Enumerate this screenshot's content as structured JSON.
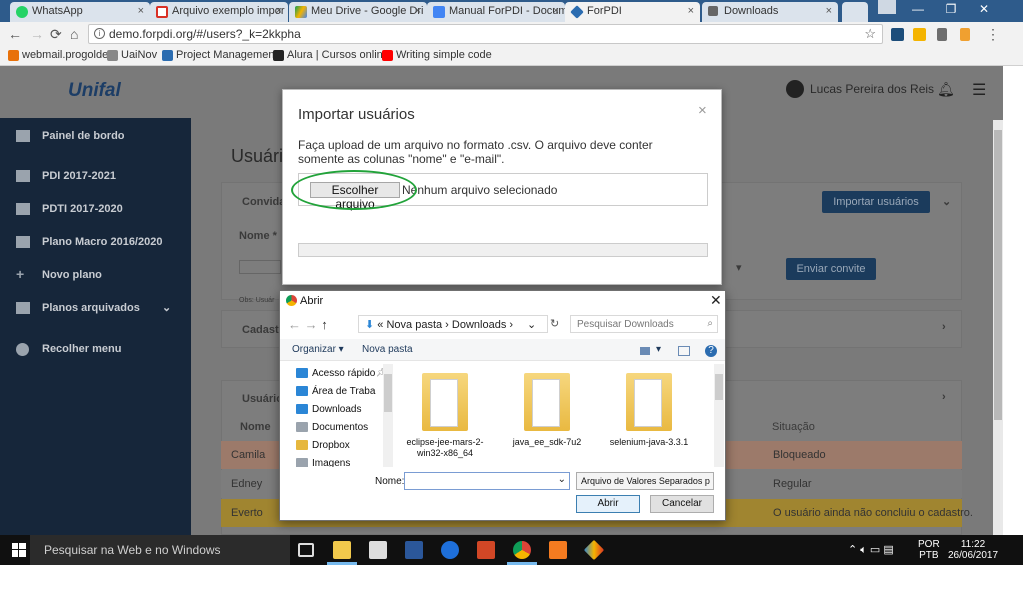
{
  "browser": {
    "tabs": [
      {
        "label": "WhatsApp",
        "color": "#25d366"
      },
      {
        "label": "Arquivo exemplo impor",
        "color": "#d93025"
      },
      {
        "label": "Meu Drive - Google Dri",
        "color": "#f4b400"
      },
      {
        "label": "Manual ForPDI - Docum",
        "color": "#4285f4"
      },
      {
        "label": "ForPDI",
        "color": "#2b6cb0"
      },
      {
        "label": "Downloads",
        "color": "#666666"
      }
    ],
    "tab_close": "×",
    "url": "demo.forpdi.org/#/users?_k=2kkpha",
    "win_min": "—",
    "win_max": "❐",
    "win_close": "✕"
  },
  "bookmarks": [
    {
      "label": "webmail.progolden",
      "color": "#e8710a"
    },
    {
      "label": "UaiNov",
      "color": "#888888"
    },
    {
      "label": "Project Management",
      "color": "#2b6cb0"
    },
    {
      "label": "Alura | Cursos online",
      "color": "#222222"
    },
    {
      "label": "Writing simple code",
      "color": "#ff0000"
    }
  ],
  "app": {
    "logo": "Unifal",
    "user": "Lucas Pereira dos Reis",
    "sidebar": [
      "Painel de bordo",
      "PDI 2017-2021",
      "PDTI 2017-2020",
      "Plano Macro 2016/2020",
      "Novo plano",
      "Planos arquivados",
      "Recolher menu"
    ],
    "page_title": "Usuári",
    "invite_section": "Convidar",
    "name_label": "Nome *",
    "hint": "Obs: Usuár",
    "import_button": "Importar usuários",
    "send_button": "Enviar convite",
    "register_section": "Cadastr",
    "users_section": "Usuário",
    "table_header_name": "Nome",
    "table_header_status": "Situação",
    "rows": [
      {
        "name": "Camila",
        "status": "Bloqueado",
        "bg": "#9c7a6a"
      },
      {
        "name": "Edney",
        "status": "Regular",
        "bg": "#7d7d7d"
      },
      {
        "name": "Everto",
        "status": "O usuário ainda não concluiu o cadastro.",
        "bg": "#a08530"
      }
    ]
  },
  "modal": {
    "title": "Importar usuários",
    "close": "×",
    "description": "Faça upload de um arquivo no formato .csv. O arquivo deve conter somente as colunas \"nome\" e \"e-mail\".",
    "file_button": "Escolher arquivo",
    "file_status": "Nenhum arquivo selecionado"
  },
  "open_dialog": {
    "title": "Abrir",
    "path_prefix": "«",
    "path": [
      "Nova pasta",
      "Downloads"
    ],
    "search_placeholder": "Pesquisar Downloads",
    "organize": "Organizar ▾",
    "new_folder": "Nova pasta",
    "help": "?",
    "tree": [
      {
        "label": "Acesso rápido",
        "color": "#2b86d6"
      },
      {
        "label": "Área de Traba",
        "color": "#2b86d6"
      },
      {
        "label": "Downloads",
        "color": "#2b86d6"
      },
      {
        "label": "Documentos",
        "color": "#9aa3ad"
      },
      {
        "label": "Dropbox",
        "color": "#e6b73e"
      },
      {
        "label": "Imagens",
        "color": "#9aa3ad"
      }
    ],
    "files": [
      "eclipse-jee-mars-2-win32-x86_64",
      "java_ee_sdk-7u2",
      "selenium-java-3.3.1"
    ],
    "name_label": "Nome:",
    "name_value": "",
    "filter": "Arquivo de Valores Separados p",
    "open_button": "Abrir",
    "cancel_button": "Cancelar"
  },
  "taskbar": {
    "search": "Pesquisar na Web e no Windows",
    "lang_1": "POR",
    "lang_2": "PTB",
    "time": "11:22",
    "date": "26/06/2017"
  }
}
